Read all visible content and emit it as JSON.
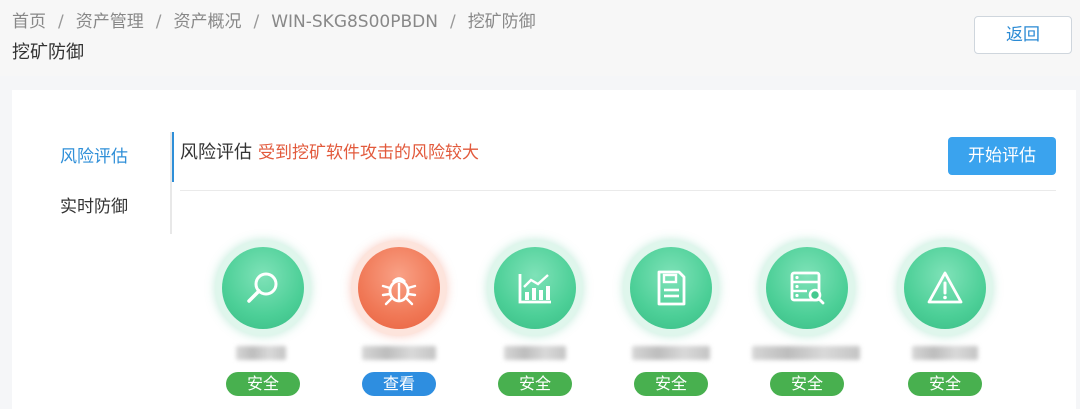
{
  "breadcrumb": [
    "首页",
    "资产管理",
    "资产概况",
    "WIN-SKG8S00PBDN",
    "挖矿防御"
  ],
  "page_title": "挖矿防御",
  "back_label": "返回",
  "sidebar": {
    "items": [
      {
        "label": "风险评估"
      },
      {
        "label": "实时防御"
      }
    ]
  },
  "section": {
    "title": "风险评估",
    "risk_text": "受到挖矿软件攻击的风险较大",
    "start_label": "开始评估"
  },
  "checks": [
    {
      "icon": "magnifier-icon",
      "status": "安全",
      "state": "safe"
    },
    {
      "icon": "bug-icon",
      "status": "查看",
      "state": "warn"
    },
    {
      "icon": "chart-icon",
      "status": "安全",
      "state": "safe"
    },
    {
      "icon": "document-icon",
      "status": "安全",
      "state": "safe"
    },
    {
      "icon": "server-search-icon",
      "status": "安全",
      "state": "safe"
    },
    {
      "icon": "warning-icon",
      "status": "安全",
      "state": "safe"
    }
  ],
  "colors": {
    "accent": "#2f8fd8",
    "danger": "#e25a3c",
    "safe_badge": "#48b04f",
    "view_badge": "#2e8ee0",
    "safe_circle": "#4ccf97",
    "warn_circle": "#f07856"
  }
}
